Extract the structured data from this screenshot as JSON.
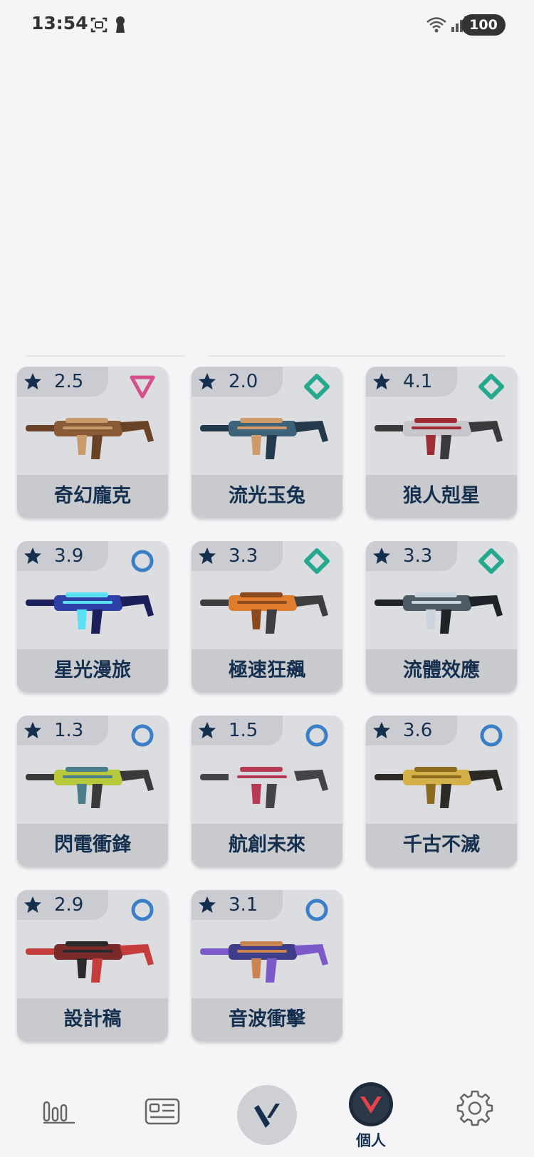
{
  "status_bar": {
    "time": "13:54",
    "battery": "100",
    "icons": [
      "screenshot-icon",
      "keyhole-icon",
      "wifi-icon",
      "signal-icon"
    ]
  },
  "colors": {
    "card_bg": "#dcdde1",
    "name_band": "#c9cace",
    "text_navy": "#14304e",
    "tier_pink": "#d6508c",
    "tier_teal": "#26a88e",
    "tier_blue": "#3b7fc7",
    "nav_accent": "#e8414d"
  },
  "skins": [
    {
      "rating": "2.5",
      "name": "奇幻龐克",
      "tier": "triangle-tier-icon",
      "palette": [
        "#8b5a36",
        "#c99b6b",
        "#6a4327"
      ]
    },
    {
      "rating": "2.0",
      "name": "流光玉兔",
      "tier": "diamond-tier-icon",
      "palette": [
        "#3c6379",
        "#d09a6a",
        "#233a4c"
      ]
    },
    {
      "rating": "4.1",
      "name": "狼人剋星",
      "tier": "diamond-tier-icon",
      "palette": [
        "#c7c7cb",
        "#9e2d36",
        "#3a3a3d"
      ]
    },
    {
      "rating": "3.9",
      "name": "星光漫旅",
      "tier": "circle-tier-icon",
      "palette": [
        "#2f3fa8",
        "#5be1f5",
        "#1b1f5a"
      ]
    },
    {
      "rating": "3.3",
      "name": "極速狂飆",
      "tier": "diamond-tier-icon",
      "palette": [
        "#e07c2e",
        "#8a4a1e",
        "#3e3e40"
      ]
    },
    {
      "rating": "3.3",
      "name": "流體效應",
      "tier": "diamond-tier-icon",
      "palette": [
        "#4d5b66",
        "#c9d4dd",
        "#1e2329"
      ]
    },
    {
      "rating": "1.3",
      "name": "閃電衝鋒",
      "tier": "circle-tier-icon",
      "palette": [
        "#b7c93a",
        "#4b7e8c",
        "#3a3a3c"
      ]
    },
    {
      "rating": "1.5",
      "name": "航創未來",
      "tier": "circle-tier-icon",
      "palette": [
        "#d9d9de",
        "#b73a55",
        "#44434a"
      ]
    },
    {
      "rating": "3.6",
      "name": "千古不滅",
      "tier": "circle-tier-icon",
      "palette": [
        "#d4b048",
        "#8c6a1e",
        "#2d2a26"
      ]
    },
    {
      "rating": "2.9",
      "name": "設計稿",
      "tier": "circle-tier-icon",
      "palette": [
        "#7b2a2a",
        "#2a2a2c",
        "#c53d3d"
      ]
    },
    {
      "rating": "3.1",
      "name": "音波衝擊",
      "tier": "circle-tier-icon",
      "palette": [
        "#3d3d8a",
        "#c98452",
        "#7d5ac9"
      ]
    }
  ],
  "bottom_nav": {
    "items": [
      {
        "icon": "stats-chart-icon"
      },
      {
        "icon": "news-icon"
      },
      {
        "icon": "valorant-logo-icon"
      },
      {
        "icon": "profile-avatar-icon",
        "label": "個人"
      },
      {
        "icon": "gear-icon"
      }
    ],
    "active_label": "個人"
  }
}
